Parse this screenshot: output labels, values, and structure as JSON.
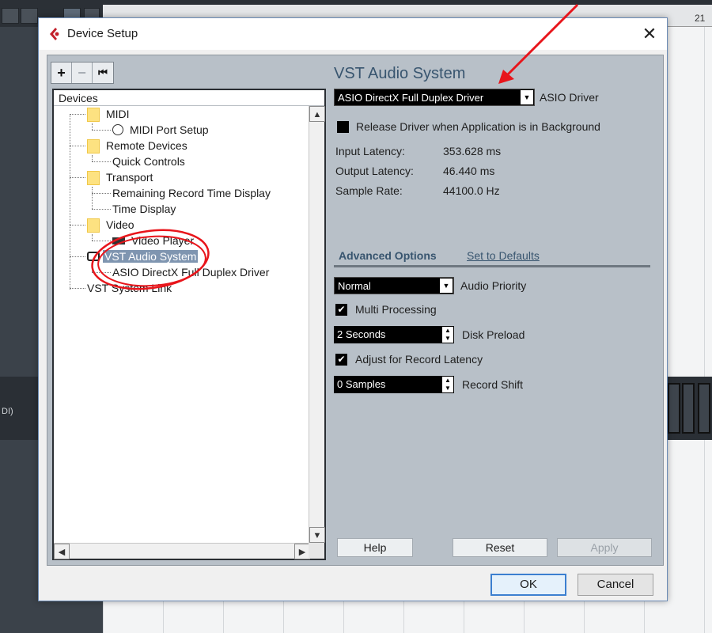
{
  "background": {
    "ruler_numbers": [
      "21"
    ],
    "left_track_text": "DI)"
  },
  "dialog": {
    "title": "Device Setup",
    "close_glyph": "✕"
  },
  "toolbar": {
    "add_glyph": "+",
    "remove_glyph": "−",
    "reset_glyph": "⏮"
  },
  "tree": {
    "header": "Devices",
    "items": [
      {
        "label": "MIDI",
        "level": 1,
        "icon": "folder-icon"
      },
      {
        "label": "MIDI Port Setup",
        "level": 2,
        "icon": "midi-port-icon"
      },
      {
        "label": "Remote Devices",
        "level": 1,
        "icon": "folder-icon"
      },
      {
        "label": "Quick Controls",
        "level": 2,
        "icon": ""
      },
      {
        "label": "Transport",
        "level": 1,
        "icon": "folder-icon"
      },
      {
        "label": "Remaining Record Time Display",
        "level": 2,
        "icon": ""
      },
      {
        "label": "Time Display",
        "level": 2,
        "icon": ""
      },
      {
        "label": "Video",
        "level": 1,
        "icon": "folder-icon"
      },
      {
        "label": "Video Player",
        "level": 2,
        "icon": "video-camera-icon"
      },
      {
        "label": "VST Audio System",
        "level": 1,
        "icon": "audio-plug-icon",
        "selected": true
      },
      {
        "label": "ASIO DirectX Full Duplex Driver",
        "level": 2,
        "icon": ""
      },
      {
        "label": "VST System Link",
        "level": 1,
        "icon": ""
      }
    ]
  },
  "vst": {
    "title": "VST Audio System",
    "driver_value": "ASIO DirectX Full Duplex Driver",
    "driver_label": "ASIO Driver",
    "release_label": "Release Driver when Application is in Background",
    "input_latency_label": "Input Latency:",
    "input_latency_value": "353.628 ms",
    "output_latency_label": "Output Latency:",
    "output_latency_value": "46.440 ms",
    "sample_rate_label": "Sample Rate:",
    "sample_rate_value": "44100.0 Hz"
  },
  "advanced": {
    "title": "Advanced Options",
    "set_defaults": "Set to Defaults",
    "audio_priority_value": "Normal",
    "audio_priority_label": "Audio Priority",
    "multi_processing_label": "Multi Processing",
    "multi_processing_checked": true,
    "disk_preload_value": "2 Seconds",
    "disk_preload_label": "Disk Preload",
    "adjust_latency_label": "Adjust for Record Latency",
    "adjust_latency_checked": true,
    "record_shift_value": "0 Samples",
    "record_shift_label": "Record Shift"
  },
  "panel_buttons": {
    "help": "Help",
    "reset": "Reset",
    "apply": "Apply"
  },
  "dialog_buttons": {
    "ok": "OK",
    "cancel": "Cancel"
  },
  "colors": {
    "accent": "#38556f",
    "annotation_red": "#e8151b",
    "selection": "#7f95b0"
  }
}
